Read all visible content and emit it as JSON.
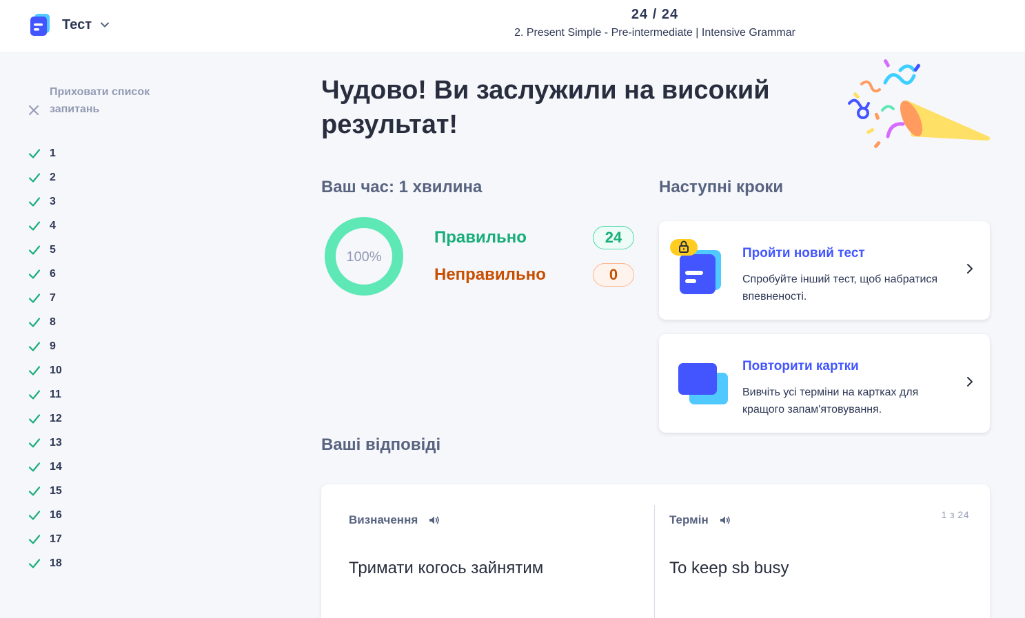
{
  "header": {
    "mode_label": "Тест",
    "progress": "24 / 24",
    "set_title": "2. Present Simple - Pre-intermediate | Intensive Grammar"
  },
  "sidebar": {
    "hide_list_label": "Приховати список запитань",
    "questions": [
      "1",
      "2",
      "3",
      "4",
      "5",
      "6",
      "7",
      "8",
      "9",
      "10",
      "11",
      "12",
      "13",
      "14",
      "15",
      "16",
      "17",
      "18"
    ]
  },
  "result": {
    "headline": "Чудово! Ви заслужили на високий результат!",
    "time_label": "Ваш час: 1 хвилина",
    "percent": "100%",
    "percent_value": 1.0,
    "correct_label": "Правильно",
    "correct_count": "24",
    "incorrect_label": "Неправильно",
    "incorrect_count": "0"
  },
  "next_steps": {
    "title": "Наступні кроки",
    "cards": [
      {
        "title": "Пройти новий тест",
        "description": "Спробуйте інший тест, щоб набратися впевненості."
      },
      {
        "title": "Повторити картки",
        "description": "Вивчіть усі терміни на картках для кращого запам'ятовування."
      }
    ]
  },
  "answers": {
    "title": "Ваші відповіді",
    "definition_header": "Визначення",
    "term_header": "Термін",
    "counter": "1 з 24",
    "definition": "Тримати когось зайнятим",
    "term": "To keep sb busy"
  },
  "colors": {
    "accent": "#4255ff",
    "correct": "#18ae79",
    "incorrect": "#c84e00",
    "donut": "#5ee8b5"
  },
  "icons": {
    "logo": "quizlet-test-logo",
    "mode_chevron": "chevron-down-icon",
    "hide": "close-icon",
    "check": "check-icon",
    "speaker": "speaker-icon",
    "card_chevron": "chevron-right-icon",
    "lock": "lock-icon"
  }
}
